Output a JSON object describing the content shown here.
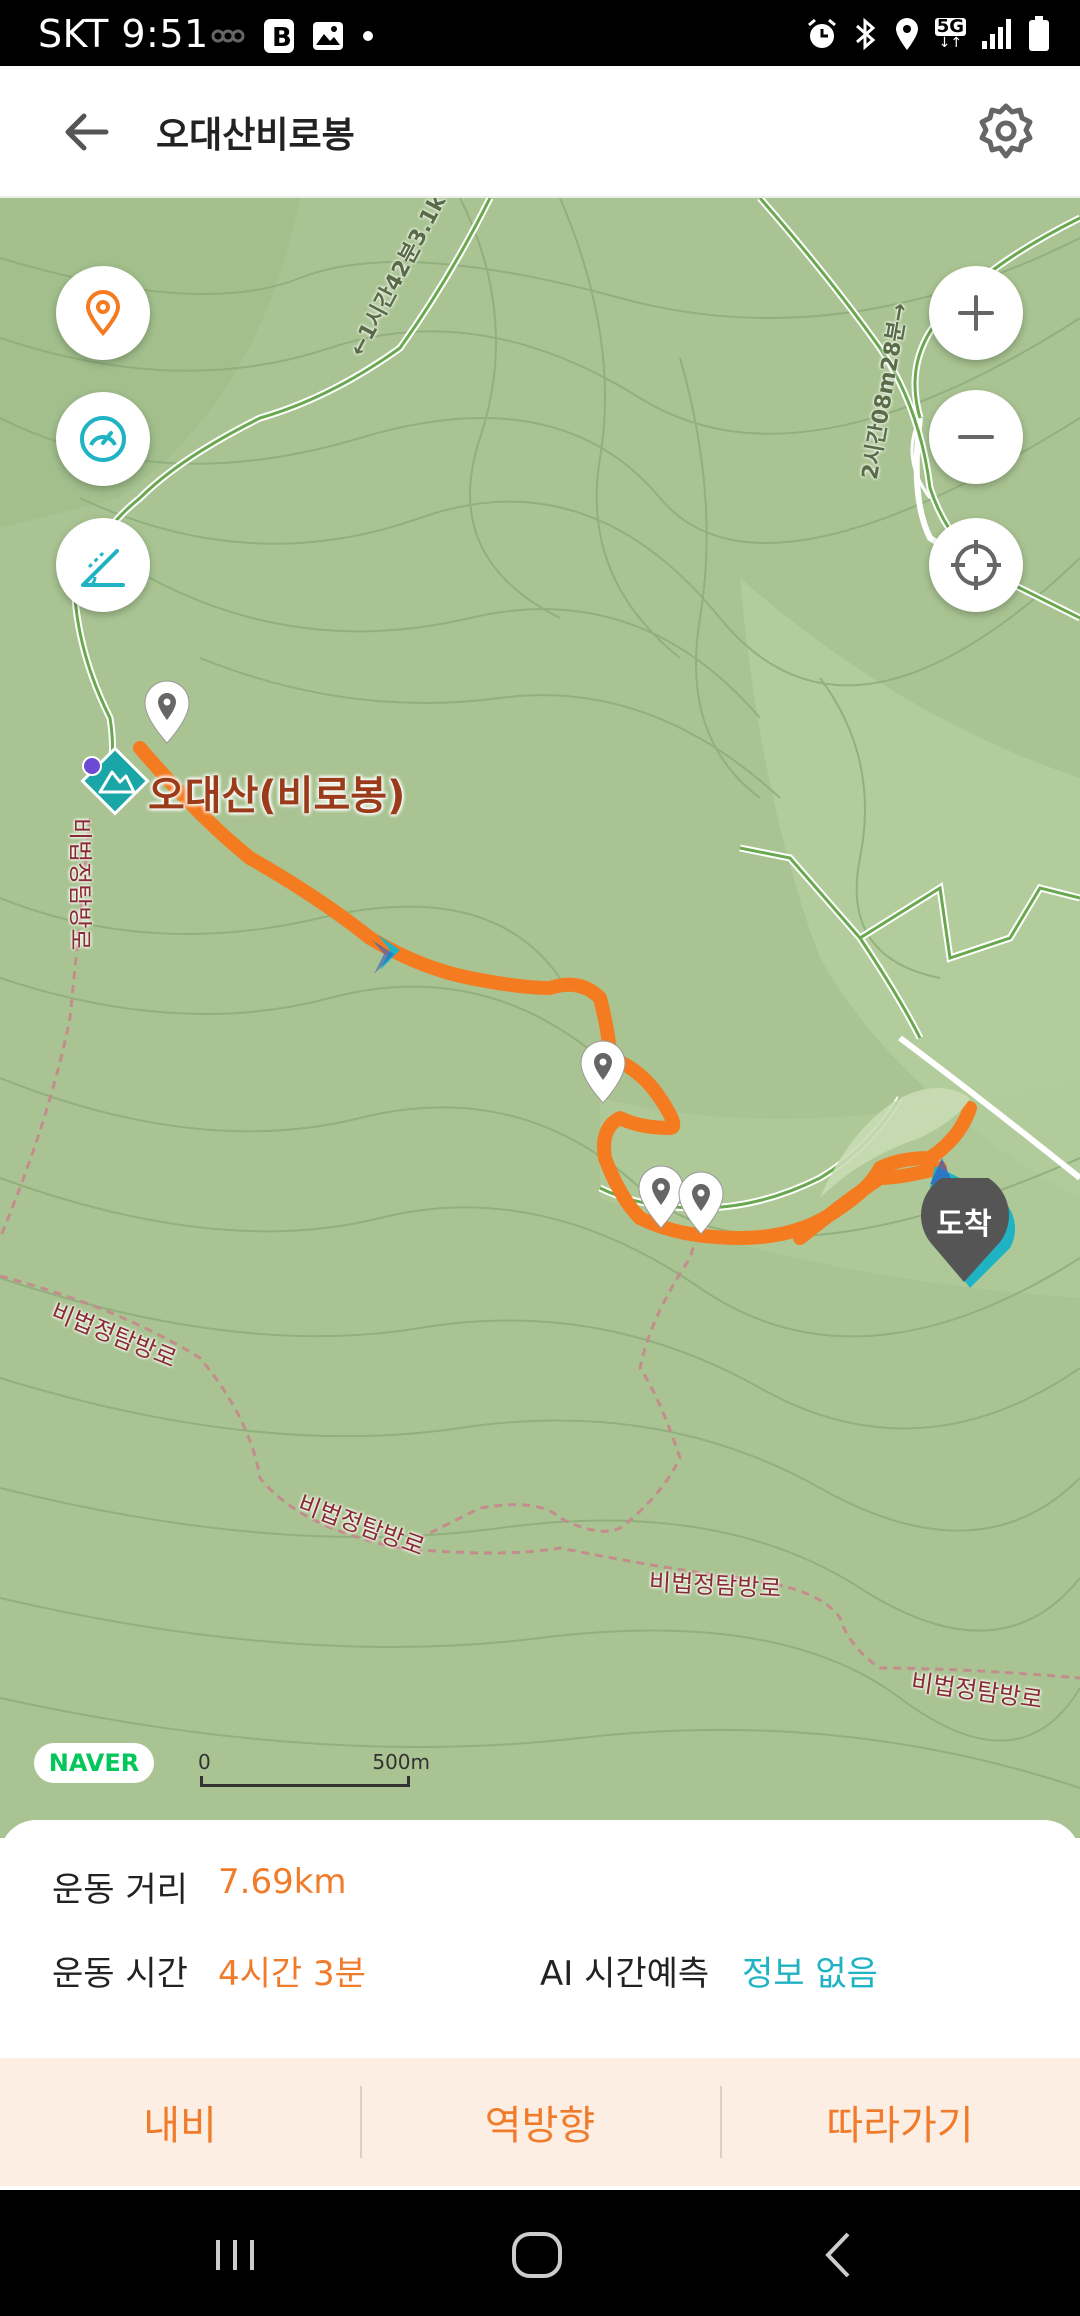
{
  "status_bar": {
    "time": "SKT 9:51",
    "network": "5G"
  },
  "app_bar": {
    "title": "오대산비로봉",
    "back_icon": "arrow-left-icon",
    "settings_icon": "gear-icon"
  },
  "map": {
    "peak_name": "오대산(비로봉)",
    "arrival_marker": "도착",
    "trail_labels": [
      "←1시간42분3.1k",
      "2시간08m28분→"
    ],
    "restricted_trail_labels": [
      "비법정탐방로",
      "비법정탐방로",
      "비법정탐방로",
      "비법정탐방로",
      "비법정탐방로"
    ],
    "brand": "NAVER",
    "scale": {
      "start": "0",
      "end": "500m"
    },
    "controls": {
      "left": [
        "location-pin-icon",
        "speedometer-icon",
        "altitude-chart-icon"
      ],
      "right": [
        "zoom-in-icon",
        "zoom-out-icon",
        "crosshair-icon"
      ]
    },
    "colors": {
      "route": "#f47b20",
      "accent": "#1fb3c4",
      "map_bg": "#a7c390"
    }
  },
  "stats": {
    "distance_label": "운동 거리",
    "distance_value": "7.69km",
    "time_label": "운동 시간",
    "time_value": "4시간 3분",
    "ai_label": "AI 시간예측",
    "ai_value": "정보 없음"
  },
  "actions": {
    "navi": "내비",
    "reverse": "역방향",
    "follow": "따라가기"
  }
}
